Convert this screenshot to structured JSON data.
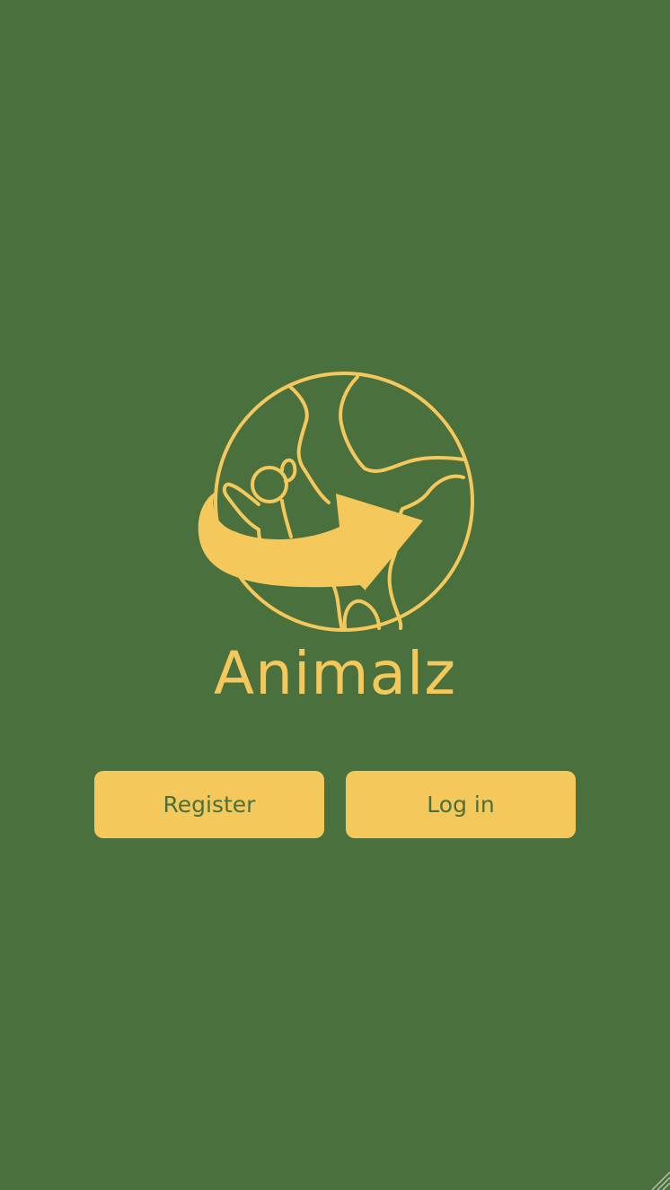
{
  "app": {
    "name": "Animalz"
  },
  "actions": {
    "register_label": "Register",
    "login_label": "Log in"
  },
  "colors": {
    "background": "#4a703e",
    "accent": "#f5c85c",
    "button_text": "#4a703e"
  },
  "icons": {
    "logo": "globe-with-animal-and-arrow-icon"
  }
}
